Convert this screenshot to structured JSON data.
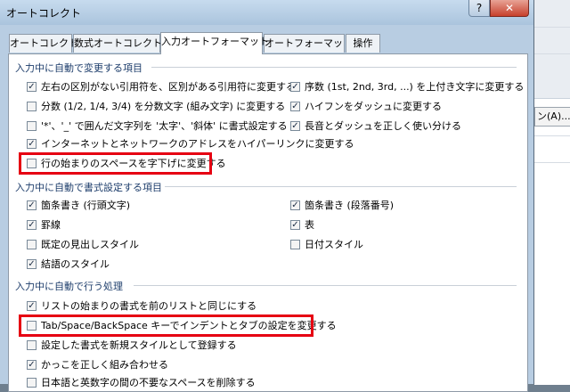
{
  "window": {
    "title": "オートコレクト",
    "help_glyph": "?",
    "close_glyph": "✕"
  },
  "background_app": {
    "button_peek_label": "ン(A)..."
  },
  "tabs": [
    {
      "label": "オートコレクト",
      "active": false
    },
    {
      "label": "数式オートコレクト",
      "active": false
    },
    {
      "label": "入力オートフォーマット",
      "active": true
    },
    {
      "label": "オートフォーマット",
      "active": false
    },
    {
      "label": "操作",
      "active": false
    }
  ],
  "sections": {
    "replace": {
      "title": "入力中に自動で変更する項目",
      "left": [
        {
          "label": "左右の区別がない引用符を、区別がある引用符に変更する",
          "checked": true
        },
        {
          "label": "分数 (1/2, 1/4, 3/4) を分数文字 (組み文字) に変更する",
          "checked": false
        },
        {
          "label": "'*'、'_' で囲んだ文字列を '太字'、'斜体' に書式設定する",
          "checked": false
        },
        {
          "label": "インターネットとネットワークのアドレスをハイパーリンクに変更する",
          "checked": true
        },
        {
          "label": "行の始まりのスペースを字下げに変更する",
          "checked": false
        }
      ],
      "right": [
        {
          "label": "序数 (1st, 2nd, 3rd, ...) を上付き文字に変更する",
          "checked": true
        },
        {
          "label": "ハイフンをダッシュに変更する",
          "checked": true
        },
        {
          "label": "長音とダッシュを正しく使い分ける",
          "checked": true
        }
      ]
    },
    "format": {
      "title": "入力中に自動で書式設定する項目",
      "left": [
        {
          "label": "箇条書き (行頭文字)",
          "checked": true
        },
        {
          "label": "罫線",
          "checked": true
        },
        {
          "label": "既定の見出しスタイル",
          "checked": false
        },
        {
          "label": "結語のスタイル",
          "checked": true
        }
      ],
      "right": [
        {
          "label": "箇条書き (段落番号)",
          "checked": true
        },
        {
          "label": "表",
          "checked": true
        },
        {
          "label": "日付スタイル",
          "checked": false
        }
      ]
    },
    "process": {
      "title": "入力中に自動で行う処理",
      "items": [
        {
          "label": "リストの始まりの書式を前のリストと同じにする",
          "checked": true
        },
        {
          "label": "Tab/Space/BackSpace キーでインデントとタブの設定を変更する",
          "checked": false
        },
        {
          "label": "設定した書式を新規スタイルとして登録する",
          "checked": false
        },
        {
          "label": "かっこを正しく組み合わせる",
          "checked": true
        },
        {
          "label": "日本語と英数字の間の不要なスペースを削除する",
          "checked": false
        }
      ]
    }
  },
  "colors": {
    "highlight": "#e60012",
    "section_title": "#1d3d6b"
  }
}
